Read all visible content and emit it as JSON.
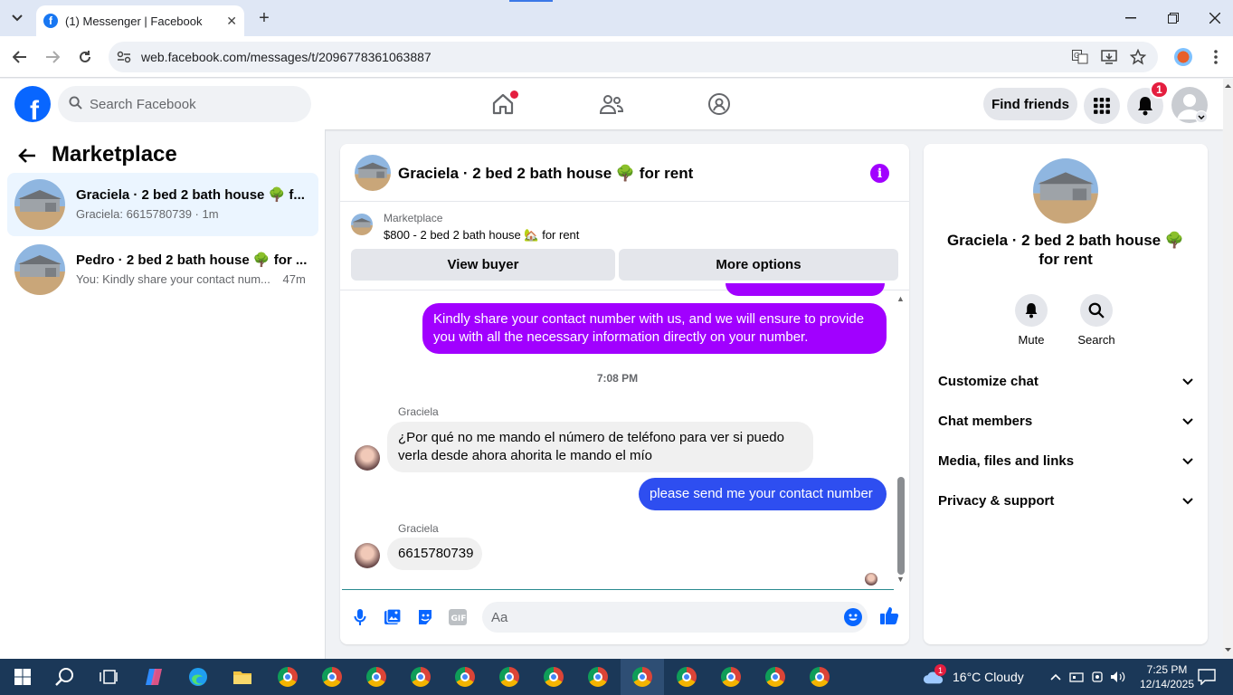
{
  "browser": {
    "tab_title": "(1) Messenger | Facebook",
    "url": "web.facebook.com/messages/t/2096778361063887"
  },
  "fb_header": {
    "search_placeholder": "Search Facebook",
    "find_friends_label": "Find friends",
    "notification_count": "1"
  },
  "left_panel": {
    "title": "Marketplace",
    "conversations": [
      {
        "title": "Graciela · 2 bed 2 bath house 🌳 f...",
        "subtitle": "Graciela: 6615780739 · 1m",
        "active": true
      },
      {
        "title": "Pedro · 2 bed 2 bath house 🌳 for ...",
        "subtitle": "You: Kindly share your contact num...",
        "time": "47m",
        "active": false
      }
    ]
  },
  "chat": {
    "title": "Graciela · 2 bed 2 bath house 🌳 for rent",
    "marketplace_label": "Marketplace",
    "listing": "$800 - 2 bed 2 bath house 🏡 for rent",
    "view_buyer_label": "View buyer",
    "more_options_label": "More options",
    "messages": [
      {
        "from": "me",
        "text": "Kindly share your contact number with us, and we will ensure to provide you with all the necessary information directly on your number."
      },
      {
        "timestamp": "7:08 PM"
      },
      {
        "from": "Graciela",
        "sender_label": "Graciela",
        "text": "¿Por qué no me mando el número de teléfono para ver si puedo verla desde ahora ahorita le mando el mío"
      },
      {
        "from": "me",
        "text": "please send me  your contact number"
      },
      {
        "from": "Graciela",
        "sender_label": "Graciela",
        "text": "6615780739"
      }
    ],
    "composer_placeholder": "Aa"
  },
  "right_panel": {
    "name": "Graciela · 2 bed 2 bath house 🌳 for rent",
    "mute_label": "Mute",
    "search_label": "Search",
    "sections": [
      "Customize chat",
      "Chat members",
      "Media, files and links",
      "Privacy & support"
    ]
  },
  "taskbar": {
    "weather": "16°C  Cloudy",
    "weather_badge": "1",
    "time": "7:25 PM",
    "date": "12/14/2025"
  },
  "colors": {
    "fb_blue": "#0866ff",
    "purple_bubble": "#a100ff",
    "blue_bubble": "#2e4ef0",
    "notif_red": "#e41e3f"
  }
}
